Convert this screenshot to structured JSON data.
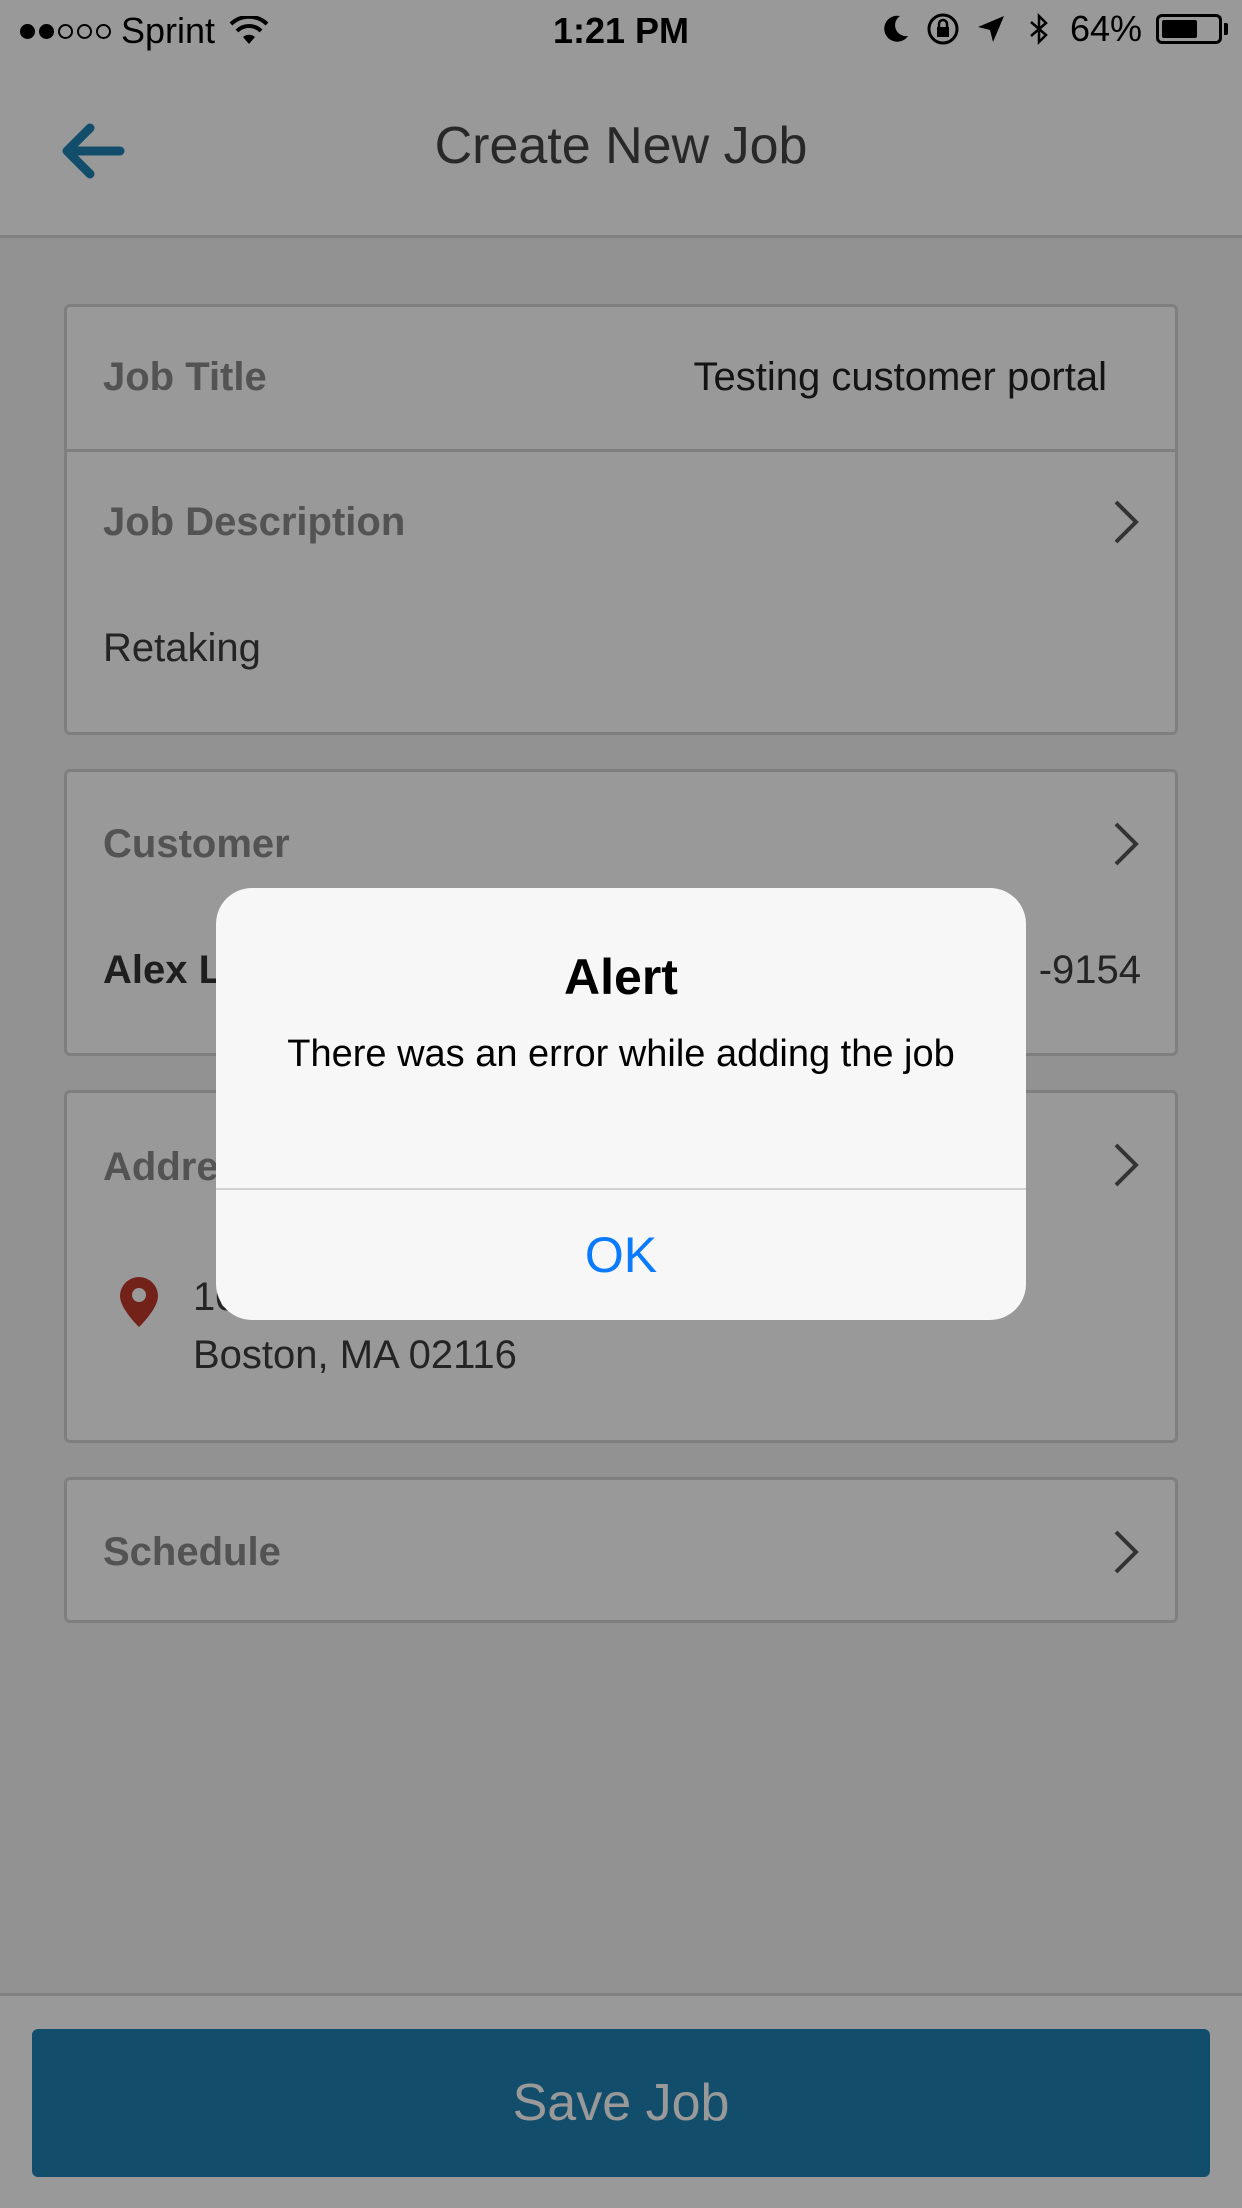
{
  "status_bar": {
    "signal_bars_filled": 2,
    "signal_bars_total": 5,
    "carrier": "Sprint",
    "time": "1:21 PM",
    "battery_percent": "64%",
    "battery_level": 0.64,
    "icons": [
      "wifi-icon",
      "moon-icon",
      "orientation-lock-icon",
      "location-arrow-icon",
      "bluetooth-icon",
      "battery-icon"
    ]
  },
  "nav": {
    "title": "Create New Job",
    "back_icon": "back-arrow-icon",
    "accent_color": "#1e83b5"
  },
  "form": {
    "job_title": {
      "label": "Job Title",
      "value": "Testing customer portal"
    },
    "job_description": {
      "label": "Job Description",
      "value": "Retaking"
    },
    "customer": {
      "label": "Customer",
      "name": "Alex L",
      "phone_partial": "-9154"
    },
    "address": {
      "label": "Addre",
      "line1": "10",
      "line2": "Boston, MA 02116",
      "pin_color": "#c0392b"
    },
    "schedule": {
      "label": "Schedule"
    }
  },
  "footer": {
    "save_label": "Save Job"
  },
  "alert": {
    "title": "Alert",
    "message": "There was an error while adding the job",
    "ok_label": "OK",
    "ok_color": "#0a7aff"
  }
}
